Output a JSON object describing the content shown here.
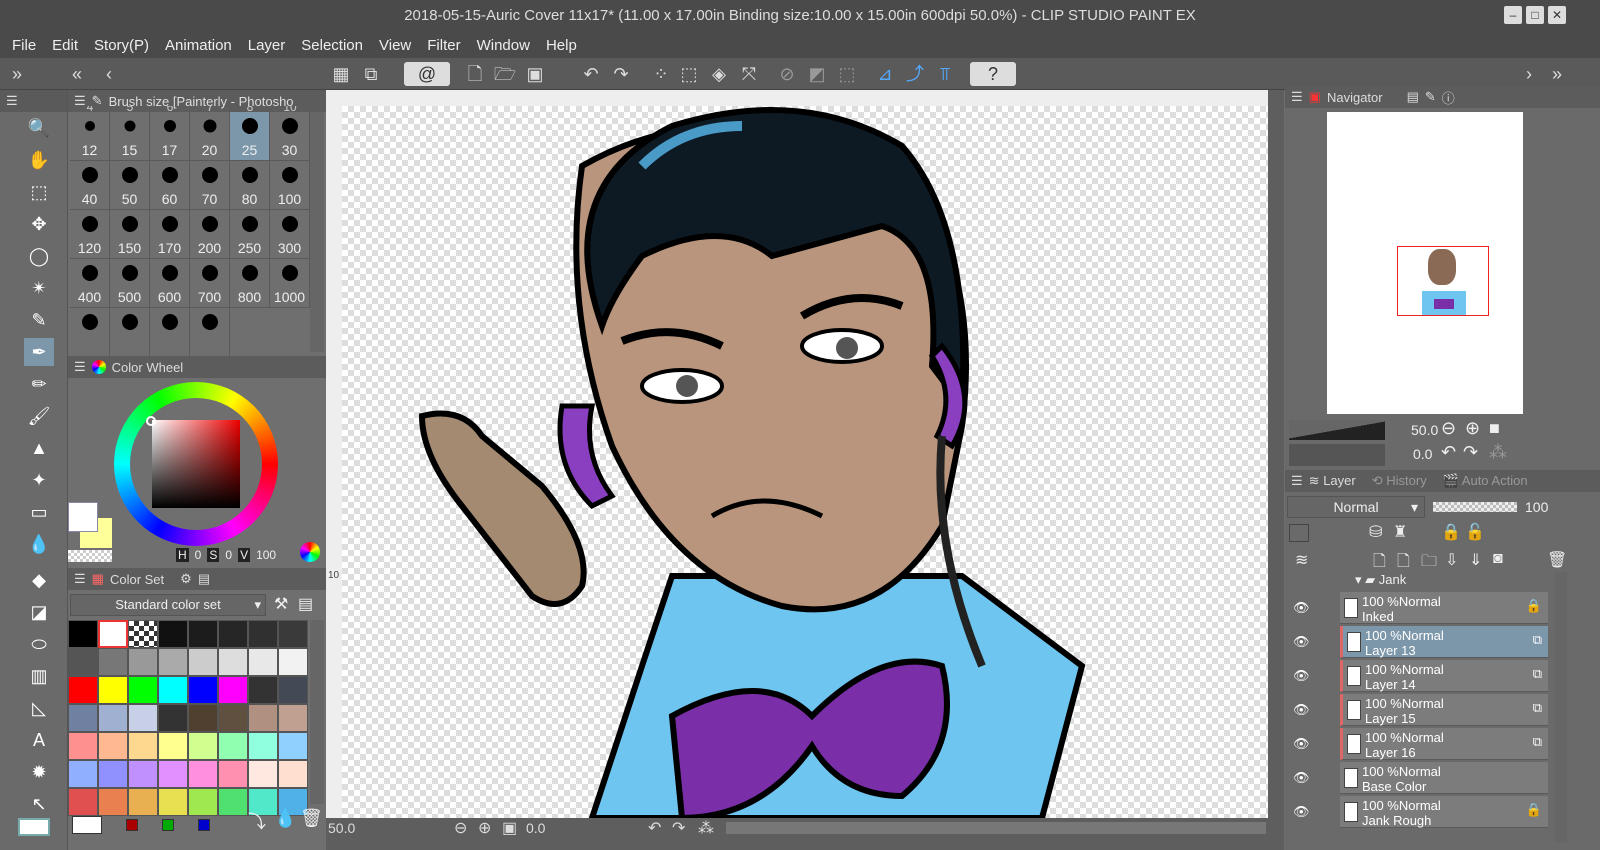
{
  "window": {
    "title": "2018-05-15-Auric Cover 11x17* (11.00 x 17.00in Binding size:10.00 x 15.00in 600dpi 50.0%)  - CLIP STUDIO PAINT EX"
  },
  "menu": [
    "File",
    "Edit",
    "Story(P)",
    "Animation",
    "Layer",
    "Selection",
    "View",
    "Filter",
    "Window",
    "Help"
  ],
  "brush_panel": {
    "title": "Brush size [Painterly - Photosho",
    "top_labels": [
      "4",
      "5",
      "6",
      "7",
      "8",
      "10"
    ],
    "sizes": [
      "12",
      "15",
      "17",
      "20",
      "25",
      "30",
      "40",
      "50",
      "60",
      "70",
      "80",
      "100",
      "120",
      "150",
      "170",
      "200",
      "250",
      "300",
      "400",
      "500",
      "600",
      "700",
      "800",
      "1000",
      "",
      "",
      "",
      ""
    ],
    "selected": "25"
  },
  "color_wheel": {
    "title": "Color Wheel",
    "h_label": "H",
    "h": "0",
    "s_label": "S",
    "s": "0",
    "v_label": "V",
    "v": "100",
    "main_color": "#ffffff",
    "sub_color": "#ffff99"
  },
  "color_set": {
    "title": "Color Set",
    "set_name": "Standard color set",
    "colors": [
      "#000000",
      "#ffffff",
      "checker",
      "#111111",
      "#1c1c1c",
      "#262626",
      "#303030",
      "#3a3a3a",
      "#555555",
      "#777777",
      "#999999",
      "#aaaaaa",
      "#cccccc",
      "#dddddd",
      "#e8e8e8",
      "#f2f2f2",
      "#ff0000",
      "#ffff00",
      "#00ff00",
      "#00ffff",
      "#0000ff",
      "#ff00ff",
      "#333333",
      "#444a55",
      "#7080a0",
      "#a0b0d0",
      "#c8d0e8",
      "#333333",
      "#504030",
      "#605040",
      "#b09080",
      "#c0a090",
      "#ff9090",
      "#ffb890",
      "#ffd890",
      "#ffff90",
      "#d0ff90",
      "#90ffb0",
      "#90ffe0",
      "#90d0ff",
      "#90b0ff",
      "#9090ff",
      "#c090ff",
      "#e090ff",
      "#ff90e0",
      "#ff90b0",
      "#ffe8e0",
      "#ffe0d0",
      "#e05050",
      "#e88050",
      "#e8b050",
      "#e8e050",
      "#a0e850",
      "#50e070",
      "#50e8c8",
      "#50b0e8"
    ],
    "history": [
      "#ffffff",
      "#aa0000",
      "#00aa00",
      "#0000cc"
    ]
  },
  "canvas_status": {
    "zoom": "50.0",
    "angle": "0.0"
  },
  "navigator": {
    "title": "Navigator",
    "zoom": "50.0",
    "angle": "0.0"
  },
  "layer_panel": {
    "tabs": [
      "Layer",
      "History",
      "Auto Action"
    ],
    "blend": "Normal",
    "opacity": "100",
    "folder": "Jank",
    "layers": [
      {
        "opacity": "100 %",
        "mode": "Normal",
        "name": "Inked",
        "locked": true,
        "selected": false
      },
      {
        "opacity": "100 %",
        "mode": "Normal",
        "name": "Layer 13",
        "locked": false,
        "selected": true
      },
      {
        "opacity": "100 %",
        "mode": "Normal",
        "name": "Layer 14",
        "locked": false,
        "selected": false
      },
      {
        "opacity": "100 %",
        "mode": "Normal",
        "name": "Layer 15",
        "locked": false,
        "selected": false
      },
      {
        "opacity": "100 %",
        "mode": "Normal",
        "name": "Layer 16",
        "locked": false,
        "selected": false
      },
      {
        "opacity": "100 %",
        "mode": "Normal",
        "name": "Base Color",
        "locked": false,
        "selected": false
      },
      {
        "opacity": "100 %",
        "mode": "Normal",
        "name": "Jank Rough",
        "locked": true,
        "selected": false
      }
    ]
  },
  "ruler": {
    "mark": "10"
  }
}
